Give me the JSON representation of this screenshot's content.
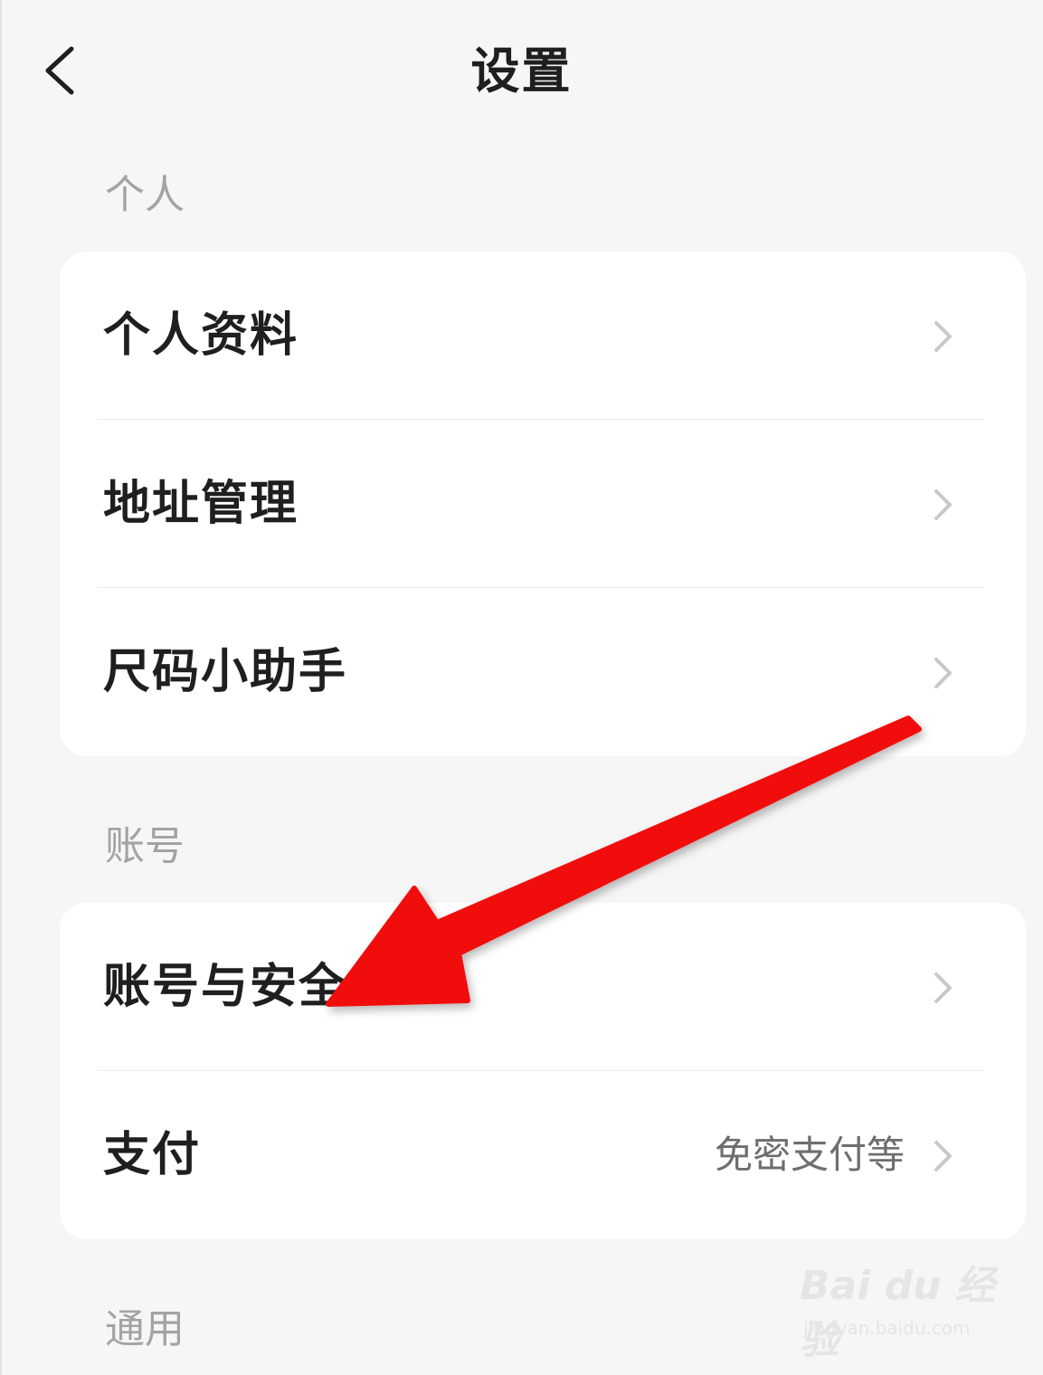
{
  "nav": {
    "title": "设置",
    "back_icon": "chevron-left-icon"
  },
  "sections": [
    {
      "label": "个人",
      "items": [
        {
          "label": "个人资料",
          "value": ""
        },
        {
          "label": "地址管理",
          "value": ""
        },
        {
          "label": "尺码小助手",
          "value": ""
        }
      ]
    },
    {
      "label": "账号",
      "items": [
        {
          "label": "账号与安全",
          "value": ""
        },
        {
          "label": "支付",
          "value": "免密支付等"
        }
      ]
    },
    {
      "label": "通用",
      "items": []
    }
  ],
  "annotation": {
    "arrow_color": "#f20d0d",
    "points_to": "账号与安全"
  },
  "watermark": {
    "logo": "Bai du 经验",
    "url": "jingyan.baidu.com"
  },
  "colors": {
    "background": "#f6f6f6",
    "card": "#ffffff",
    "section_label": "#a3a3a3",
    "item_label": "#1f1f1f",
    "item_value": "#6e6e6e",
    "chevron": "#c8c8c8"
  }
}
